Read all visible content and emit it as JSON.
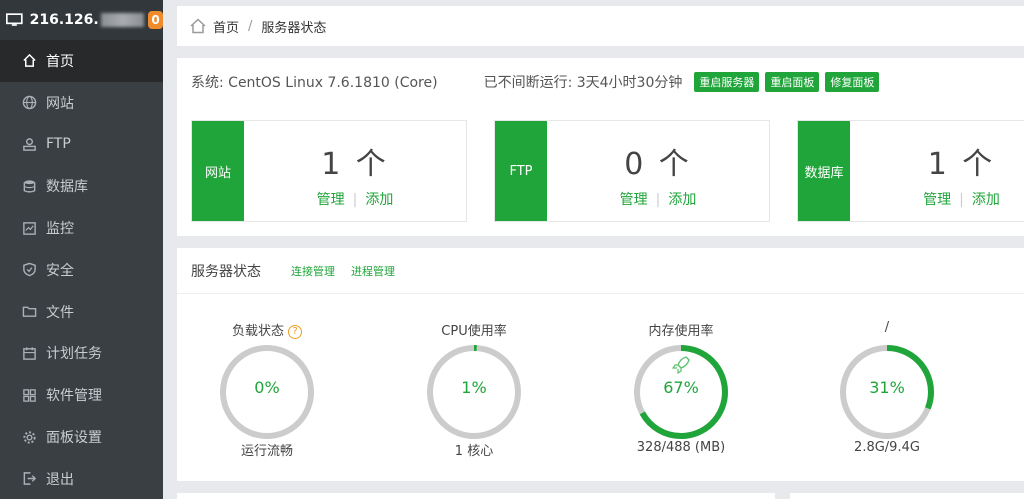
{
  "server": {
    "ip_visible": "216.126.",
    "notice_count": "0"
  },
  "sidebar": {
    "items": [
      {
        "label": "首页",
        "icon": "home-icon",
        "active": true
      },
      {
        "label": "网站",
        "icon": "globe-icon"
      },
      {
        "label": "FTP",
        "icon": "ftp-icon"
      },
      {
        "label": "数据库",
        "icon": "database-icon"
      },
      {
        "label": "监控",
        "icon": "monitor-icon"
      },
      {
        "label": "安全",
        "icon": "shield-icon"
      },
      {
        "label": "文件",
        "icon": "folder-icon"
      },
      {
        "label": "计划任务",
        "icon": "calendar-icon"
      },
      {
        "label": "软件管理",
        "icon": "apps-icon"
      },
      {
        "label": "面板设置",
        "icon": "gear-icon"
      },
      {
        "label": "退出",
        "icon": "logout-icon"
      }
    ]
  },
  "breadcrumb": {
    "home": "首页",
    "sep": "/",
    "current": "服务器状态"
  },
  "system": {
    "os": "系统: CentOS Linux 7.6.1810 (Core)",
    "uptime": "已不间断运行: 3天4小时30分钟",
    "buttons": [
      "重启服务器",
      "重启面板",
      "修复面板"
    ]
  },
  "stats": [
    {
      "tag": "网站",
      "count": "1 个",
      "manage": "管理",
      "add": "添加"
    },
    {
      "tag": "FTP",
      "count": "0 个",
      "manage": "管理",
      "add": "添加"
    },
    {
      "tag": "数据库",
      "count": "1 个",
      "manage": "管理",
      "add": "添加"
    }
  ],
  "server_status": {
    "title": "服务器状态",
    "links": [
      "连接管理",
      "进程管理"
    ],
    "gauges": [
      {
        "title": "负载状态",
        "value": "0%",
        "percent": 0,
        "sub": "运行流畅"
      },
      {
        "title": "CPU使用率",
        "value": "1%",
        "percent": 1,
        "sub": "1 核心"
      },
      {
        "title": "内存使用率",
        "value": "67%",
        "percent": 67,
        "sub": "328/488 (MB)"
      },
      {
        "title": "/",
        "value": "31%",
        "percent": 31,
        "sub": "2.8G/9.4G"
      }
    ]
  },
  "colors": {
    "accent": "#20a53a",
    "sidebar": "#3a3f44",
    "badge": "#f08b2c",
    "track": "#cccccc"
  }
}
